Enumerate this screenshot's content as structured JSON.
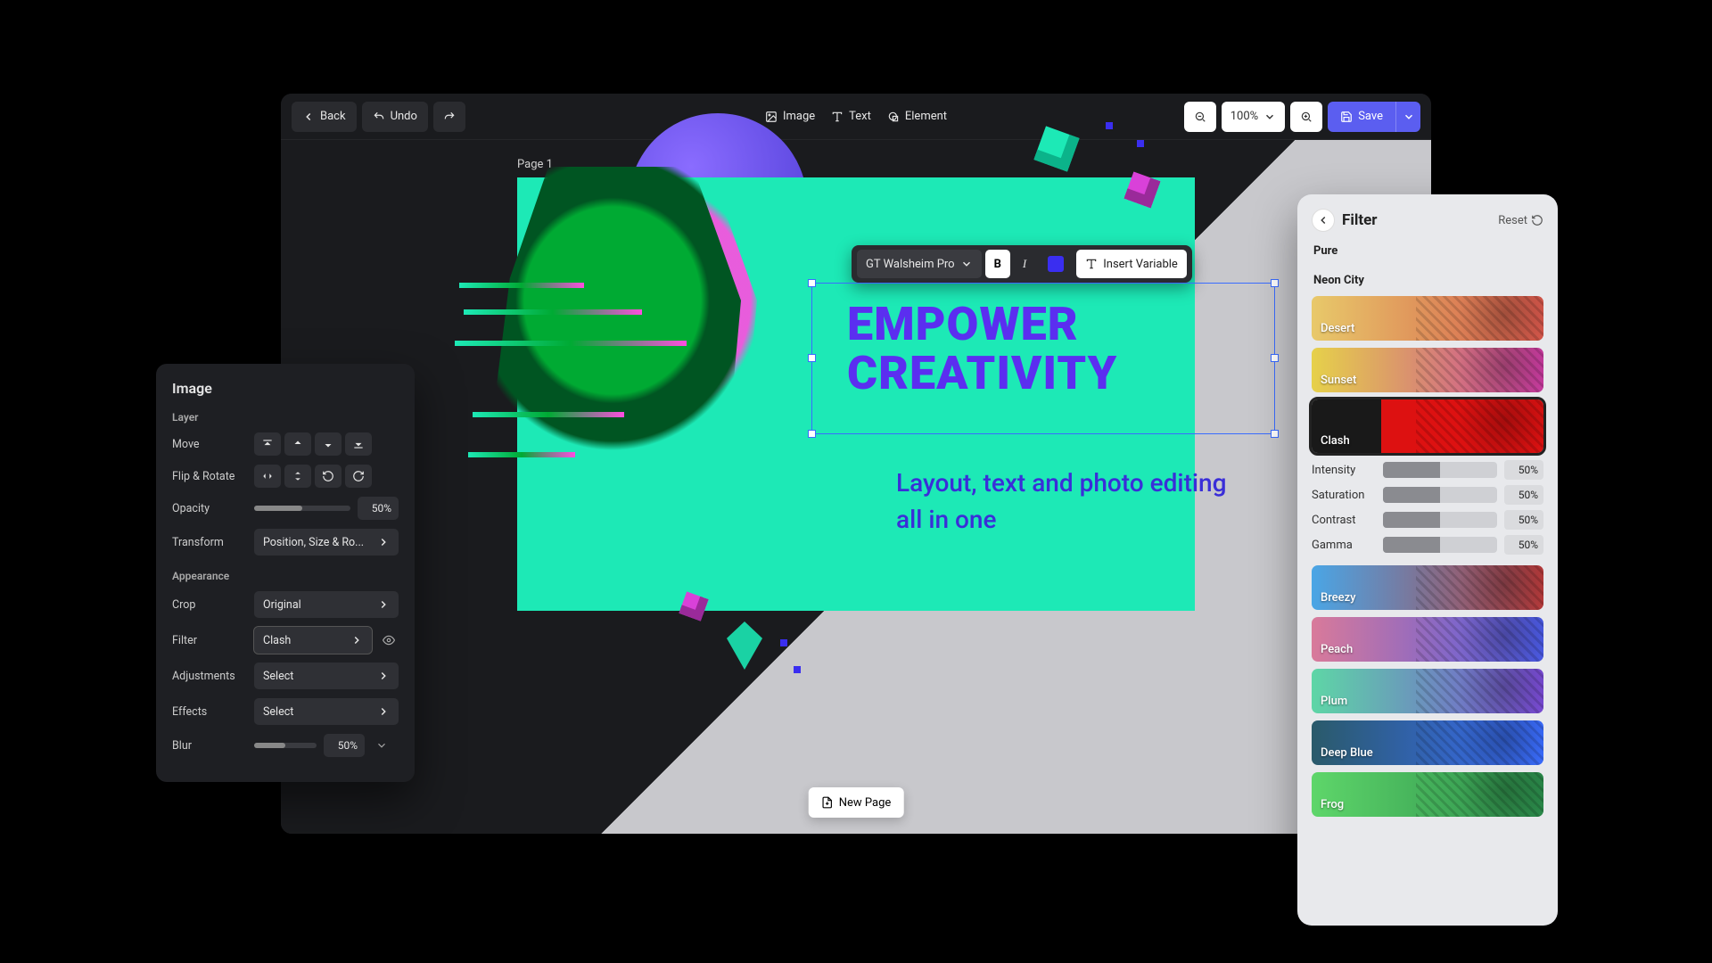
{
  "topbar": {
    "back": "Back",
    "undo": "Undo",
    "image": "Image",
    "text": "Text",
    "element": "Element",
    "zoom": "100%",
    "save": "Save"
  },
  "canvas": {
    "page_label": "Page 1",
    "headline_l1": "EMPOWER",
    "headline_l2": "CREATIVITY",
    "subhead": "Layout, text and photo editing all in one",
    "new_page": "New Page"
  },
  "text_toolbar": {
    "font": "GT Walsheim Pro",
    "bold": "B",
    "italic": "I",
    "insert_var": "Insert Variable"
  },
  "image_panel": {
    "title": "Image",
    "sec_layer": "Layer",
    "move": "Move",
    "flip_rotate": "Flip & Rotate",
    "opacity": "Opacity",
    "opacity_val": "50%",
    "transform": "Transform",
    "transform_val": "Position, Size & Ro...",
    "sec_appearance": "Appearance",
    "crop": "Crop",
    "crop_val": "Original",
    "filter": "Filter",
    "filter_val": "Clash",
    "adjustments": "Adjustments",
    "adjust_val": "Select",
    "effects": "Effects",
    "effects_val": "Select",
    "blur": "Blur",
    "blur_val": "50%"
  },
  "filter_panel": {
    "title": "Filter",
    "reset": "Reset",
    "sec_pure": "Pure",
    "sec_neon": "Neon City",
    "swatches": [
      "Desert",
      "Sunset",
      "Clash",
      "Breezy",
      "Peach",
      "Plum",
      "Deep Blue",
      "Frog"
    ],
    "selected": "Clash",
    "sliders": {
      "intensity": {
        "label": "Intensity",
        "val": "50%"
      },
      "saturation": {
        "label": "Saturation",
        "val": "50%"
      },
      "contrast": {
        "label": "Contrast",
        "val": "50%"
      },
      "gamma": {
        "label": "Gamma",
        "val": "50%"
      }
    }
  }
}
